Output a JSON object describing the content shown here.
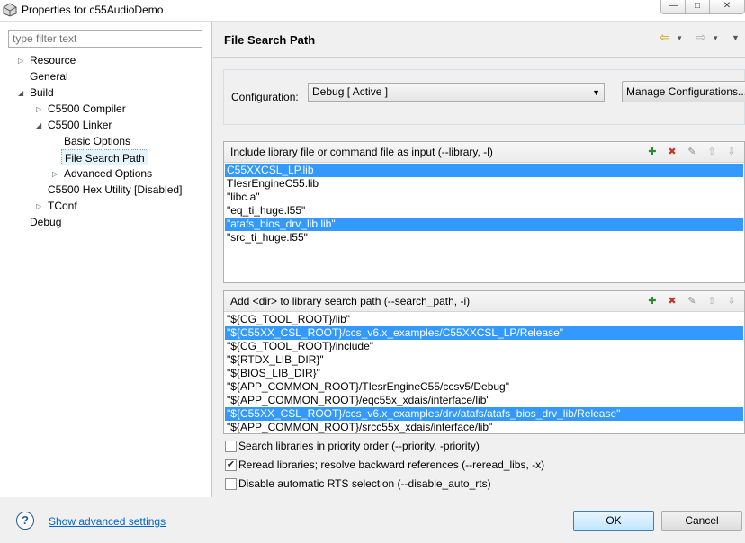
{
  "window": {
    "title": "Properties for c55AudioDemo",
    "min_glyph": "—",
    "max_glyph": "□",
    "close_glyph": "✕"
  },
  "left_pane": {
    "filter_placeholder": "type filter text",
    "tree": [
      {
        "label": "Resource",
        "twisty": "▷"
      },
      {
        "label": "General",
        "twisty": ""
      },
      {
        "label": "Build",
        "twisty": "◢"
      },
      {
        "label": "C5500 Compiler",
        "twisty": "▷"
      },
      {
        "label": "C5500 Linker",
        "twisty": "◢"
      },
      {
        "label": "Basic Options",
        "twisty": ""
      },
      {
        "label": "File Search Path",
        "twisty": "",
        "selected": true
      },
      {
        "label": "Advanced Options",
        "twisty": "▷"
      },
      {
        "label": "C5500 Hex Utility  [Disabled]",
        "twisty": ""
      },
      {
        "label": "TConf",
        "twisty": "▷"
      },
      {
        "label": "Debug",
        "twisty": ""
      }
    ]
  },
  "right_pane": {
    "title": "File Search Path",
    "nav": {
      "back_glyph": "⇦",
      "fwd_glyph": "⇨",
      "dropdown_glyph": "▾",
      "menu_glyph": "▼"
    },
    "config": {
      "label": "Configuration:",
      "value": "Debug  [ Active ]",
      "manage_label": "Manage Configurations..."
    },
    "libraries": {
      "header": "Include library file or command file as input (--library, -l)",
      "items": [
        {
          "text": "C55XXCSL_LP.lib",
          "selected": true
        },
        {
          "text": "TIesrEngineC55.lib",
          "selected": false
        },
        {
          "text": "\"libc.a\"",
          "selected": false
        },
        {
          "text": "\"eq_ti_huge.l55\"",
          "selected": false
        },
        {
          "text": "\"atafs_bios_drv_lib.lib\"",
          "selected": true
        },
        {
          "text": "\"src_ti_huge.l55\"",
          "selected": false
        }
      ]
    },
    "search_paths": {
      "header": "Add <dir> to library search path (--search_path, -i)",
      "items": [
        {
          "text": "\"${CG_TOOL_ROOT}/lib\"",
          "selected": false
        },
        {
          "text": "\"${C55XX_CSL_ROOT}/ccs_v6.x_examples/C55XXCSL_LP/Release\"",
          "selected": true
        },
        {
          "text": "\"${CG_TOOL_ROOT}/include\"",
          "selected": false
        },
        {
          "text": "\"${RTDX_LIB_DIR}\"",
          "selected": false
        },
        {
          "text": "\"${BIOS_LIB_DIR}\"",
          "selected": false
        },
        {
          "text": "\"${APP_COMMON_ROOT}/TIesrEngineC55/ccsv5/Debug\"",
          "selected": false
        },
        {
          "text": "\"${APP_COMMON_ROOT}/eqc55x_xdais/interface/lib\"",
          "selected": false
        },
        {
          "text": "\"${C55XX_CSL_ROOT}/ccs_v6.x_examples/drv/atafs/atafs_bios_drv_lib/Release\"",
          "selected": true
        },
        {
          "text": "\"${APP_COMMON_ROOT}/srcc55x_xdais/interface/lib\"",
          "selected": false
        }
      ]
    },
    "options": [
      {
        "label": "Search libraries in priority order (--priority, -priority)",
        "checked": false
      },
      {
        "label": "Reread libraries; resolve backward references (--reread_libs, -x)",
        "checked": true
      },
      {
        "label": "Disable automatic RTS selection (--disable_auto_rts)",
        "checked": false
      }
    ]
  },
  "footer": {
    "help_glyph": "?",
    "advanced_link": "Show advanced settings",
    "ok_label": "OK",
    "cancel_label": "Cancel"
  },
  "colors": {
    "selection": "#3399ff",
    "link": "#0066cc"
  }
}
